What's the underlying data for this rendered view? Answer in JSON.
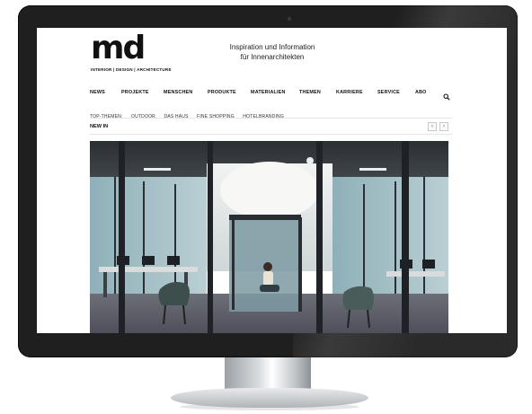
{
  "site": {
    "logo_text": "md",
    "logo_subline": "INTERIOR | DESIGN | ARCHITECTURE",
    "tagline_line1": "Inspiration und Information",
    "tagline_line2": "für Innenarchitekten"
  },
  "main_nav": [
    {
      "label": "NEWS"
    },
    {
      "label": "PROJEKTE"
    },
    {
      "label": "MENSCHEN"
    },
    {
      "label": "PRODUKTE"
    },
    {
      "label": "MATERIALIEN"
    },
    {
      "label": "THEMEN"
    },
    {
      "label": "KARRIERE"
    },
    {
      "label": "SERVICE"
    },
    {
      "label": "ABO"
    }
  ],
  "search_icon": "search-icon",
  "sub_nav": [
    {
      "label": "TOP-THEMEN:"
    },
    {
      "label": "OUTDOOR"
    },
    {
      "label": "DAS HAUS"
    },
    {
      "label": "FINE SHOPPING"
    },
    {
      "label": "HOTELBRANDING"
    }
  ],
  "section": {
    "title": "NEW IN",
    "prev_arrow": "‹",
    "next_arrow": "›"
  },
  "hero_image": "office-interior-photo",
  "colors": {
    "bezel": "#1f1f1f",
    "text": "#111111",
    "separator": "#e5e5e5"
  }
}
